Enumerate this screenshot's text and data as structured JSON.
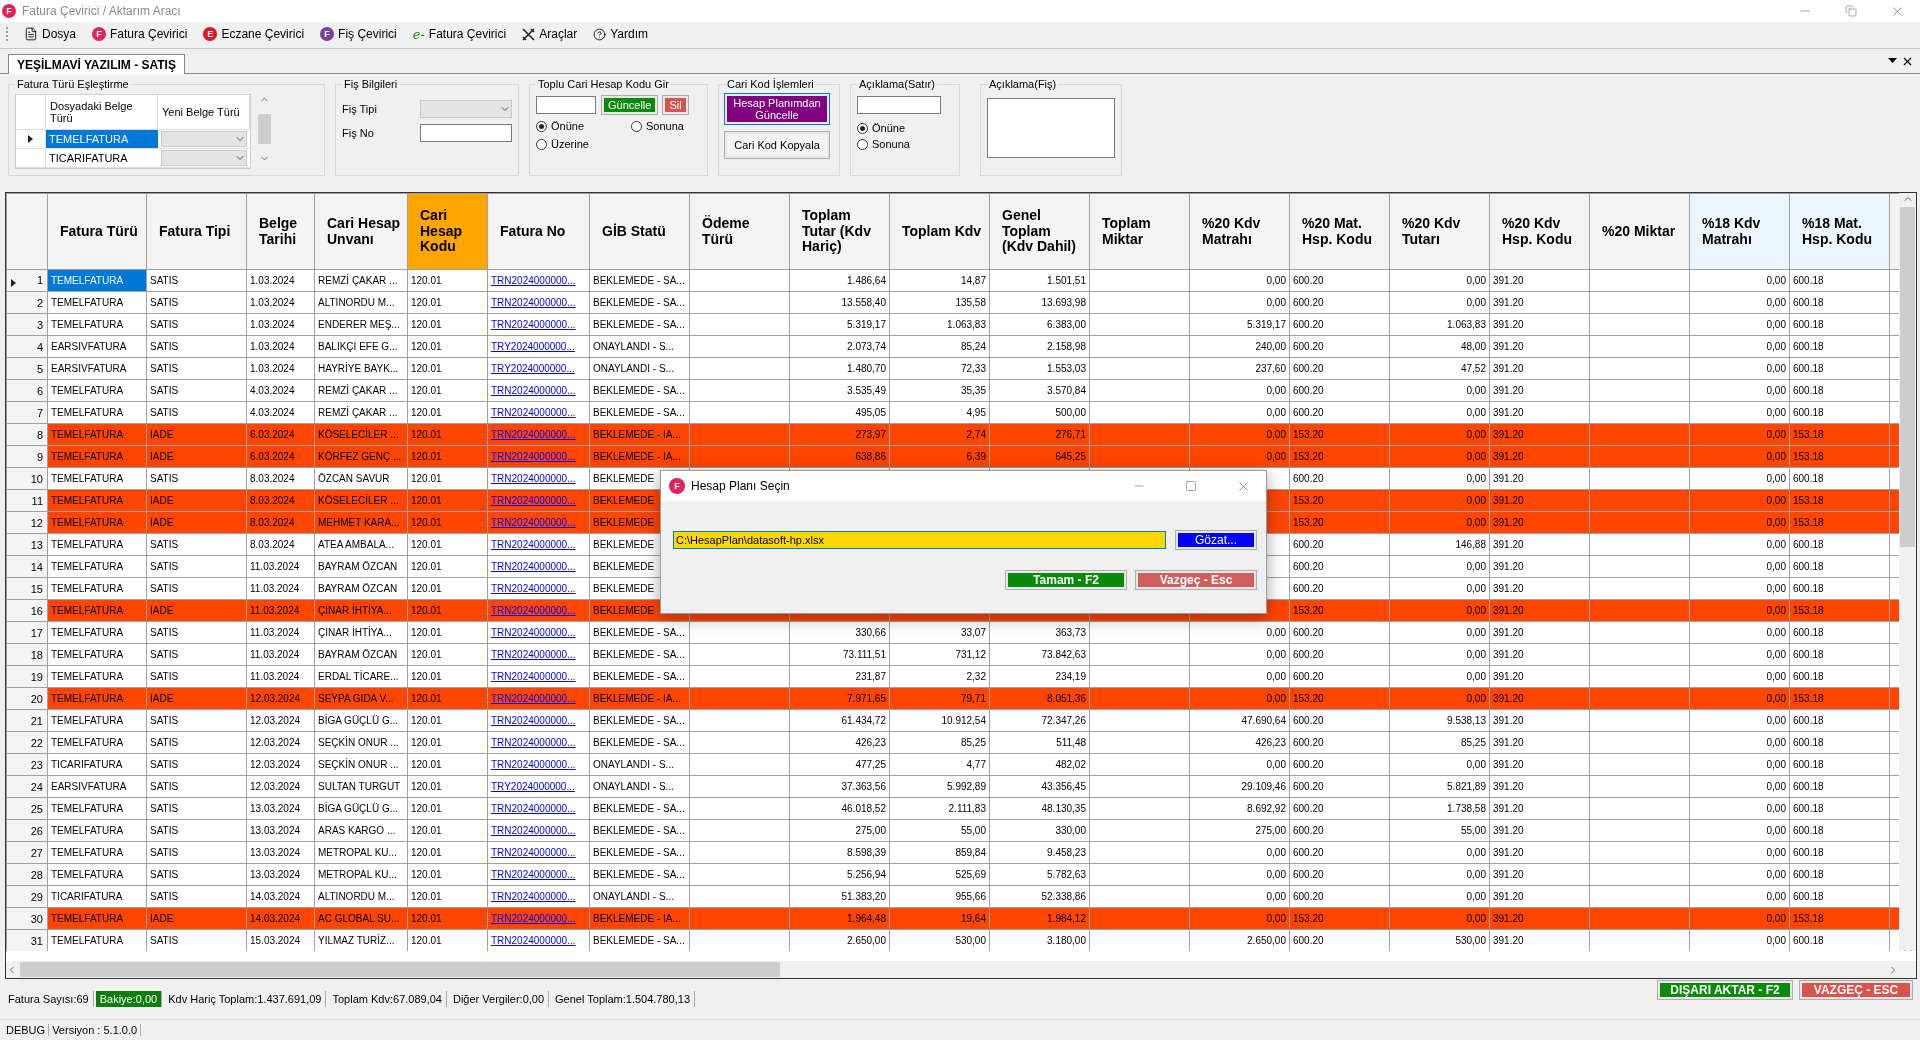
{
  "window": {
    "title": "Fatura Çevirici / Aktarım Aracı",
    "icon_letter": "F"
  },
  "menu": [
    {
      "label": "Dosya",
      "kind": "document"
    },
    {
      "label": "Fatura Çevirici",
      "kind": "badge",
      "badge": "F",
      "color": "#e0245e"
    },
    {
      "label": "Eczane Çevirici",
      "kind": "badge",
      "badge": "E",
      "color": "#e81123"
    },
    {
      "label": "Fiş Çevirici",
      "kind": "badge",
      "badge": "F",
      "color": "#7b3fa0"
    },
    {
      "label": "Fatura Çevirici",
      "kind": "efatura",
      "badge": "e-"
    },
    {
      "label": "Araçlar",
      "kind": "tools"
    },
    {
      "label": "Yardım",
      "kind": "help"
    }
  ],
  "tabs": [
    {
      "label": "YEŞİLMAVİ YAZILIM - SATIŞ",
      "selected": true
    }
  ],
  "mapping": {
    "title": "Fatura Türü Eşleştirme",
    "columns": [
      "Dosyadaki Belge Türü",
      "Yeni Belge Türü"
    ],
    "rows": [
      {
        "source": "TEMELFATURA",
        "selected": true
      },
      {
        "source": "TICARIFATURA",
        "selected": false
      }
    ]
  },
  "fis": {
    "title": "Fiş Bilgileri",
    "type_label": "Fiş Tipi",
    "no_label": "Fiş No"
  },
  "bulk": {
    "title": "Toplu Cari Hesap Kodu Gir",
    "update": "Güncelle",
    "delete": "Sil",
    "options": [
      {
        "label": "Önüne",
        "selected": true
      },
      {
        "label": "Sonuna",
        "selected": false
      },
      {
        "label": "Üzerine",
        "selected": false
      }
    ]
  },
  "code_ops": {
    "title": "Cari Kod İşlemleri",
    "update_from_plan": "Hesap Planımdan Güncelle",
    "copy": "Cari Kod Kopyala"
  },
  "line_note": {
    "title": "Açıklama(Satır)",
    "options": [
      {
        "label": "Önüne",
        "selected": true
      },
      {
        "label": "Sonuna",
        "selected": false
      }
    ]
  },
  "slip_note": {
    "title": "Açıklama(Fiş)"
  },
  "grid": {
    "columns": [
      {
        "label": "Fatura Türü",
        "kind": "text"
      },
      {
        "label": "Fatura Tipi",
        "kind": "text"
      },
      {
        "label": "Belge Tarihi",
        "kind": "text"
      },
      {
        "label": "Cari Hesap Unvanı",
        "kind": "text"
      },
      {
        "label": "Cari Hesap Kodu",
        "kind": "text",
        "color": "#ffa500"
      },
      {
        "label": "Fatura No",
        "kind": "link"
      },
      {
        "label": "GİB Statü",
        "kind": "text"
      },
      {
        "label": "Ödeme Türü",
        "kind": "text"
      },
      {
        "label": "Toplam Tutar (Kdv Hariç)",
        "kind": "number"
      },
      {
        "label": "Toplam Kdv",
        "kind": "number"
      },
      {
        "label": "Genel Toplam (Kdv Dahil)",
        "kind": "number"
      },
      {
        "label": "Toplam Miktar",
        "kind": "number"
      },
      {
        "label": "%20 Kdv Matrahı",
        "kind": "number"
      },
      {
        "label": "%20 Mat. Hsp. Kodu",
        "kind": "text"
      },
      {
        "label": "%20 Kdv Tutarı",
        "kind": "number"
      },
      {
        "label": "%20 Kdv Hsp. Kodu",
        "kind": "text"
      },
      {
        "label": "%20 Miktar",
        "kind": "number"
      },
      {
        "label": "%18 Kdv Matrahı",
        "kind": "number",
        "color": "#eef6fd"
      },
      {
        "label": "%18 Mat. Hsp. Kodu",
        "kind": "text",
        "color": "#eef6fd"
      }
    ],
    "rows": [
      {
        "no": "1",
        "kind": "satis",
        "selected": true,
        "cells": [
          "TEMELFATURA",
          "SATIS",
          "1.03.2024",
          "REMZİ ÇAKAR ...",
          "120.01",
          "TRN2024000000...",
          "BEKLEMEDE - SA...",
          null,
          "1.486,64",
          "14,87",
          "1.501,51",
          null,
          "0,00",
          "600.20",
          "0,00",
          "391.20",
          null,
          "0,00",
          "600.18"
        ]
      },
      {
        "no": "2",
        "kind": "satis",
        "selected": false,
        "cells": [
          "TEMELFATURA",
          "SATIS",
          "1.03.2024",
          "ALTINORDU M...",
          "120.01",
          "TRN2024000000...",
          "BEKLEMEDE - SA...",
          null,
          "13.558,40",
          "135,58",
          "13.693,98",
          null,
          "0,00",
          "600.20",
          "0,00",
          "391.20",
          null,
          "0,00",
          "600.18"
        ]
      },
      {
        "no": "3",
        "kind": "satis",
        "selected": false,
        "cells": [
          "TEMELFATURA",
          "SATIS",
          "1.03.2024",
          "ENDERER MEŞ...",
          "120.01",
          "TRN2024000000...",
          "BEKLEMEDE - SA...",
          null,
          "5.319,17",
          "1.063,83",
          "6.383,00",
          null,
          "5.319,17",
          "600.20",
          "1.063,83",
          "391.20",
          null,
          "0,00",
          "600.18"
        ]
      },
      {
        "no": "4",
        "kind": "satis",
        "selected": false,
        "cells": [
          "EARSIVFATURA",
          "SATIS",
          "1.03.2024",
          "BALIKÇI EFE G...",
          "120.01",
          "TRY2024000000...",
          "ONAYLANDI - S...",
          null,
          "2.073,74",
          "85,24",
          "2.158,98",
          null,
          "240,00",
          "600.20",
          "48,00",
          "391.20",
          null,
          "0,00",
          "600.18"
        ]
      },
      {
        "no": "5",
        "kind": "satis",
        "selected": false,
        "cells": [
          "EARSIVFATURA",
          "SATIS",
          "1.03.2024",
          "HAYRİYE BAYK...",
          "120.01",
          "TRY2024000000...",
          "ONAYLANDI - S...",
          null,
          "1.480,70",
          "72,33",
          "1.553,03",
          null,
          "237,60",
          "600.20",
          "47,52",
          "391.20",
          null,
          "0,00",
          "600.18"
        ]
      },
      {
        "no": "6",
        "kind": "satis",
        "selected": false,
        "cells": [
          "TEMELFATURA",
          "SATIS",
          "4.03.2024",
          "REMZİ ÇAKAR ...",
          "120.01",
          "TRN2024000000...",
          "BEKLEMEDE - SA...",
          null,
          "3.535,49",
          "35,35",
          "3.570,84",
          null,
          "0,00",
          "600.20",
          "0,00",
          "391.20",
          null,
          "0,00",
          "600.18"
        ]
      },
      {
        "no": "7",
        "kind": "satis",
        "selected": false,
        "cells": [
          "TEMELFATURA",
          "SATIS",
          "4.03.2024",
          "REMZİ ÇAKAR ...",
          "120.01",
          "TRN2024000000...",
          "BEKLEMEDE - SA...",
          null,
          "495,05",
          "4,95",
          "500,00",
          null,
          "0,00",
          "600.20",
          "0,00",
          "391.20",
          null,
          "0,00",
          "600.18"
        ]
      },
      {
        "no": "8",
        "kind": "iade",
        "selected": false,
        "cells": [
          "TEMELFATURA",
          "IADE",
          "6.03.2024",
          "KÖSELECİLER ...",
          "120.01",
          "TRN2024000000...",
          "BEKLEMEDE - IA...",
          null,
          "273,97",
          "2,74",
          "276,71",
          null,
          "0,00",
          "153.20",
          "0,00",
          "391.20",
          null,
          "0,00",
          "153.18"
        ]
      },
      {
        "no": "9",
        "kind": "iade",
        "selected": false,
        "cells": [
          "TEMELFATURA",
          "IADE",
          "6.03.2024",
          "KÖRFEZ GENÇ ...",
          "120.01",
          "TRN2024000000...",
          "BEKLEMEDE - IA...",
          null,
          "638,86",
          "6,39",
          "645,25",
          null,
          "0,00",
          "153.20",
          "0,00",
          "391.20",
          null,
          "0,00",
          "153.18"
        ]
      },
      {
        "no": "10",
        "kind": "satis",
        "selected": false,
        "cells": [
          "TEMELFATURA",
          "SATIS",
          "8.03.2024",
          "ÖZCAN SAVUR",
          "120.01",
          "TRN2024000000...",
          "BEKLEMEDE",
          null,
          null,
          null,
          null,
          null,
          null,
          "600.20",
          "0,00",
          "391.20",
          null,
          "0,00",
          "600.18"
        ]
      },
      {
        "no": "11",
        "kind": "iade",
        "selected": false,
        "cells": [
          "TEMELFATURA",
          "IADE",
          "8.03.2024",
          "KÖSELECİLER ...",
          "120.01",
          "TRN2024000000...",
          "BEKLEMEDE",
          null,
          null,
          null,
          null,
          null,
          null,
          "153.20",
          "0,00",
          "391.20",
          null,
          "0,00",
          "153.18"
        ]
      },
      {
        "no": "12",
        "kind": "iade",
        "selected": false,
        "cells": [
          "TEMELFATURA",
          "IADE",
          "8.03.2024",
          "MEHMET KARA...",
          "120.01",
          "TRN2024000000...",
          "BEKLEMEDE",
          null,
          null,
          null,
          null,
          null,
          null,
          "153.20",
          "0,00",
          "391.20",
          null,
          "0,00",
          "153.18"
        ]
      },
      {
        "no": "13",
        "kind": "satis",
        "selected": false,
        "cells": [
          "TEMELFATURA",
          "SATIS",
          "8.03.2024",
          "ATEA AMBALA...",
          "120.01",
          "TRN2024000000...",
          "BEKLEMEDE",
          null,
          null,
          null,
          null,
          null,
          null,
          "600.20",
          "146,88",
          "391.20",
          null,
          "0,00",
          "600.18"
        ]
      },
      {
        "no": "14",
        "kind": "satis",
        "selected": false,
        "cells": [
          "TEMELFATURA",
          "SATIS",
          "11.03.2024",
          "BAYRAM ÖZCAN",
          "120.01",
          "TRN2024000000...",
          "BEKLEMEDE",
          null,
          null,
          null,
          null,
          null,
          null,
          "600.20",
          "0,00",
          "391.20",
          null,
          "0,00",
          "600.18"
        ]
      },
      {
        "no": "15",
        "kind": "satis",
        "selected": false,
        "cells": [
          "TEMELFATURA",
          "SATIS",
          "11.03.2024",
          "BAYRAM ÖZCAN",
          "120.01",
          "TRN2024000000...",
          "BEKLEMEDE",
          null,
          null,
          null,
          null,
          null,
          null,
          "600.20",
          "0,00",
          "391.20",
          null,
          "0,00",
          "600.18"
        ]
      },
      {
        "no": "16",
        "kind": "iade",
        "selected": false,
        "cells": [
          "TEMELFATURA",
          "IADE",
          "11.03.2024",
          "ÇINAR İHTİYA...",
          "120.01",
          "TRN2024000000...",
          "BEKLEMEDE",
          null,
          null,
          null,
          null,
          null,
          null,
          "153.20",
          "0,00",
          "391.20",
          null,
          "0,00",
          "153.18"
        ]
      },
      {
        "no": "17",
        "kind": "satis",
        "selected": false,
        "cells": [
          "TEMELFATURA",
          "SATIS",
          "11.03.2024",
          "ÇINAR İHTİYA...",
          "120.01",
          "TRN2024000000...",
          "BEKLEMEDE - SA...",
          null,
          "330,66",
          "33,07",
          "363,73",
          null,
          "0,00",
          "600.20",
          "0,00",
          "391.20",
          null,
          "0,00",
          "600.18"
        ]
      },
      {
        "no": "18",
        "kind": "satis",
        "selected": false,
        "cells": [
          "TEMELFATURA",
          "SATIS",
          "11.03.2024",
          "BAYRAM ÖZCAN",
          "120.01",
          "TRN2024000000...",
          "BEKLEMEDE - SA...",
          null,
          "73.111,51",
          "731,12",
          "73.842,63",
          null,
          "0,00",
          "600.20",
          "0,00",
          "391.20",
          null,
          "0,00",
          "600.18"
        ]
      },
      {
        "no": "19",
        "kind": "satis",
        "selected": false,
        "cells": [
          "TEMELFATURA",
          "SATIS",
          "11.03.2024",
          "ERDAL TİCARE...",
          "120.01",
          "TRN2024000000...",
          "BEKLEMEDE - SA...",
          null,
          "231,87",
          "2,32",
          "234,19",
          null,
          "0,00",
          "600.20",
          "0,00",
          "391.20",
          null,
          "0,00",
          "600.18"
        ]
      },
      {
        "no": "20",
        "kind": "iade",
        "selected": false,
        "cells": [
          "TEMELFATURA",
          "IADE",
          "12.03.2024",
          "SEYPA GIDA V...",
          "120.01",
          "TRN2024000000...",
          "BEKLEMEDE - IA...",
          null,
          "7.971,65",
          "79,71",
          "8.051,36",
          null,
          "0,00",
          "153.20",
          "0,00",
          "391.20",
          null,
          "0,00",
          "153.18"
        ]
      },
      {
        "no": "21",
        "kind": "satis",
        "selected": false,
        "cells": [
          "TEMELFATURA",
          "SATIS",
          "12.03.2024",
          "BİGA GÜÇLÜ G...",
          "120.01",
          "TRN2024000000...",
          "BEKLEMEDE - SA...",
          null,
          "61.434,72",
          "10.912,54",
          "72.347,26",
          null,
          "47.690,64",
          "600.20",
          "9.538,13",
          "391.20",
          null,
          "0,00",
          "600.18"
        ]
      },
      {
        "no": "22",
        "kind": "satis",
        "selected": false,
        "cells": [
          "TEMELFATURA",
          "SATIS",
          "12.03.2024",
          "SEÇKİN ONUR ...",
          "120.01",
          "TRN2024000000...",
          "BEKLEMEDE - SA...",
          null,
          "426,23",
          "85,25",
          "511,48",
          null,
          "426,23",
          "600.20",
          "85,25",
          "391.20",
          null,
          "0,00",
          "600.18"
        ]
      },
      {
        "no": "23",
        "kind": "satis",
        "selected": false,
        "cells": [
          "TICARIFATURA",
          "SATIS",
          "12.03.2024",
          "SEÇKİN ONUR ...",
          "120.01",
          "TRN2024000000...",
          "ONAYLANDI - S...",
          null,
          "477,25",
          "4,77",
          "482,02",
          null,
          "0,00",
          "600.20",
          "0,00",
          "391.20",
          null,
          "0,00",
          "600.18"
        ]
      },
      {
        "no": "24",
        "kind": "satis",
        "selected": false,
        "cells": [
          "EARSIVFATURA",
          "SATIS",
          "12.03.2024",
          "SULTAN TURGUT",
          "120.01",
          "TRY2024000000...",
          "ONAYLANDI - S...",
          null,
          "37.363,56",
          "5.992,89",
          "43.356,45",
          null,
          "29.109,46",
          "600.20",
          "5.821,89",
          "391.20",
          null,
          "0,00",
          "600.18"
        ]
      },
      {
        "no": "25",
        "kind": "satis",
        "selected": false,
        "cells": [
          "TEMELFATURA",
          "SATIS",
          "13.03.2024",
          "BİGA GÜÇLÜ G...",
          "120.01",
          "TRN2024000000...",
          "BEKLEMEDE - SA...",
          null,
          "46.018,52",
          "2.111,83",
          "48.130,35",
          null,
          "8.692,92",
          "600.20",
          "1.738,58",
          "391.20",
          null,
          "0,00",
          "600.18"
        ]
      },
      {
        "no": "26",
        "kind": "satis",
        "selected": false,
        "cells": [
          "TEMELFATURA",
          "SATIS",
          "13.03.2024",
          "ARAS KARGO ...",
          "120.01",
          "TRN2024000000...",
          "BEKLEMEDE - SA...",
          null,
          "275,00",
          "55,00",
          "330,00",
          null,
          "275,00",
          "600.20",
          "55,00",
          "391.20",
          null,
          "0,00",
          "600.18"
        ]
      },
      {
        "no": "27",
        "kind": "satis",
        "selected": false,
        "cells": [
          "TEMELFATURA",
          "SATIS",
          "13.03.2024",
          "METROPAL KU...",
          "120.01",
          "TRN2024000000...",
          "BEKLEMEDE - SA...",
          null,
          "8.598,39",
          "859,84",
          "9.458,23",
          null,
          "0,00",
          "600.20",
          "0,00",
          "391.20",
          null,
          "0,00",
          "600.18"
        ]
      },
      {
        "no": "28",
        "kind": "satis",
        "selected": false,
        "cells": [
          "TEMELFATURA",
          "SATIS",
          "13.03.2024",
          "METROPAL KU...",
          "120.01",
          "TRN2024000000...",
          "BEKLEMEDE - SA...",
          null,
          "5.256,94",
          "525,69",
          "5.782,63",
          null,
          "0,00",
          "600.20",
          "0,00",
          "391.20",
          null,
          "0,00",
          "600.18"
        ]
      },
      {
        "no": "29",
        "kind": "satis",
        "selected": false,
        "cells": [
          "TICARIFATURA",
          "SATIS",
          "14.03.2024",
          "ALTINORDU M...",
          "120.01",
          "TRN2024000000...",
          "ONAYLANDI - S...",
          null,
          "51.383,20",
          "955,66",
          "52.338,86",
          null,
          "0,00",
          "600.20",
          "0,00",
          "391.20",
          null,
          "0,00",
          "600.18"
        ]
      },
      {
        "no": "30",
        "kind": "iade",
        "selected": false,
        "cells": [
          "TEMELFATURA",
          "IADE",
          "14.03.2024",
          "AC GLOBAL SU...",
          "120.01",
          "TRN2024000000...",
          "BEKLEMEDE - IA...",
          null,
          "1.964,48",
          "19,64",
          "1.984,12",
          null,
          "0,00",
          "153.20",
          "0,00",
          "391.20",
          null,
          "0,00",
          "153.18"
        ]
      },
      {
        "no": "31",
        "kind": "satis",
        "selected": false,
        "cells": [
          "TEMELFATURA",
          "SATIS",
          "15.03.2024",
          "YILMAZ TURİZ...",
          "120.01",
          "TRN2024000000...",
          "BEKLEMEDE - SA...",
          null,
          "2.650,00",
          "530,00",
          "3.180,00",
          null,
          "2.650,00",
          "600.20",
          "530,00",
          "391.20",
          null,
          "0,00",
          "600.18"
        ]
      }
    ]
  },
  "dialog": {
    "title": "Hesap Planı Seçin",
    "icon_letter": "F",
    "path": "C:\\HesapPlan\\datasoft-hp.xlsx",
    "browse": "Gözat...",
    "ok": "Tamam - F2",
    "cancel": "Vazgeç - Esc"
  },
  "status": [
    {
      "label": "Fatura Sayısı:69",
      "highlighted": false
    },
    {
      "label": "Bakiye:0,00",
      "highlighted": true
    },
    {
      "label": "Kdv Hariç Toplam:1.437.691,09",
      "highlighted": false
    },
    {
      "label": "Toplam Kdv:67.089,04",
      "highlighted": false
    },
    {
      "label": "Diğer Vergiler:0,00",
      "highlighted": false
    },
    {
      "label": "Genel Toplam:1.504.780,13",
      "highlighted": false
    }
  ],
  "actions": {
    "export": "DIŞARI AKTAR - F2",
    "cancel": "VAZGEÇ - ESC"
  },
  "footer": [
    "DEBUG",
    "Versiyon : 5.1.0.0"
  ]
}
